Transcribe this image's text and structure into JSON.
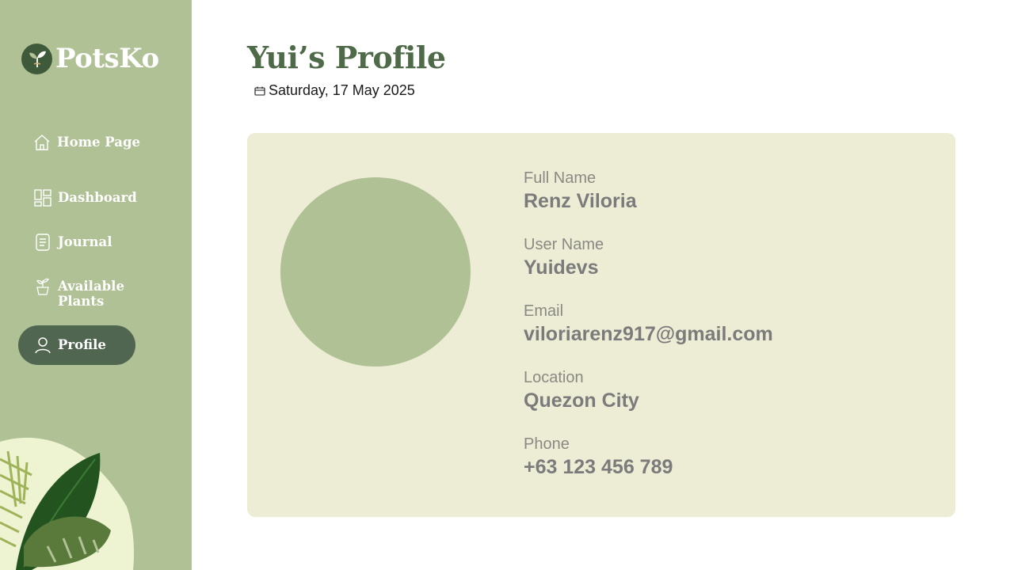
{
  "brand": {
    "name": "PotsKo"
  },
  "sidebar": {
    "items": [
      {
        "label": "Home Page",
        "icon": "home-icon"
      },
      {
        "label": "Dashboard",
        "icon": "dashboard-icon"
      },
      {
        "label": "Journal",
        "icon": "journal-icon"
      },
      {
        "label": "Available Plants",
        "icon": "plant-pot-icon"
      },
      {
        "label": "Profile",
        "icon": "user-icon",
        "active": true
      }
    ]
  },
  "header": {
    "title": "Yui’s Profile",
    "date": "Saturday, 17 May 2025"
  },
  "profile": {
    "fields": [
      {
        "label": "Full Name",
        "value": "Renz Viloria"
      },
      {
        "label": "User Name",
        "value": "Yuidevs"
      },
      {
        "label": "Email",
        "value": "viloriarenz917@gmail.com"
      },
      {
        "label": "Location",
        "value": "Quezon City"
      },
      {
        "label": "Phone",
        "value": "+63 123 456 789"
      }
    ]
  },
  "colors": {
    "sidebar_bg": "#b0c196",
    "active_nav_bg": "#506650",
    "title_green": "#4f6a48",
    "card_bg": "#edecd4",
    "avatar_bg": "#b0c196"
  }
}
